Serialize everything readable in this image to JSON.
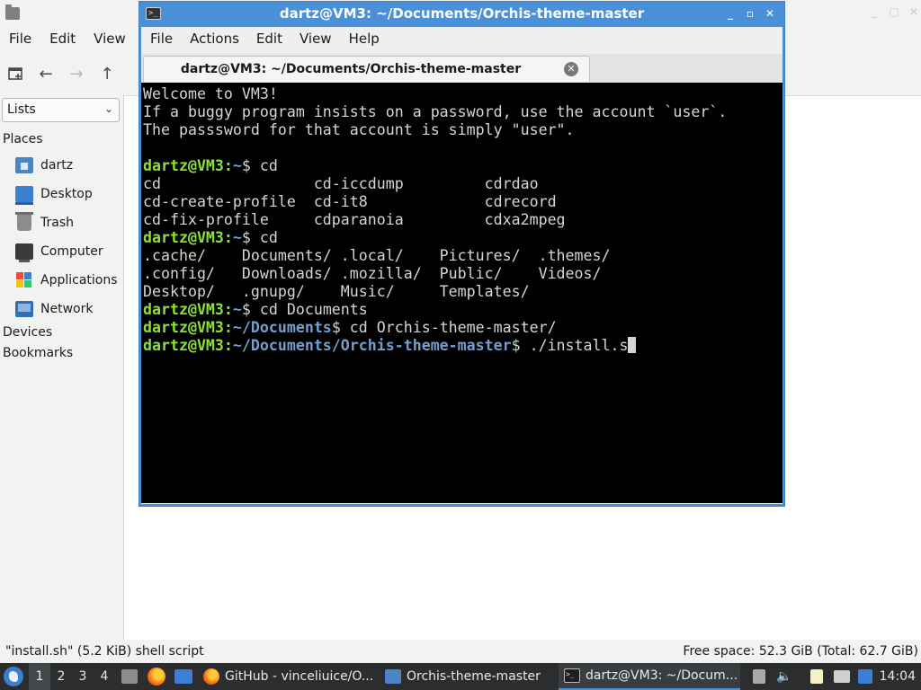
{
  "file_manager": {
    "menu": [
      "File",
      "Edit",
      "View"
    ],
    "sidebar": {
      "select_value": "Lists",
      "places_heading": "Places",
      "places": [
        {
          "label": "dartz",
          "icon": "home-folder-icon"
        },
        {
          "label": "Desktop",
          "icon": "desktop-icon"
        },
        {
          "label": "Trash",
          "icon": "trash-icon"
        },
        {
          "label": "Computer",
          "icon": "computer-icon"
        },
        {
          "label": "Applications",
          "icon": "applications-icon"
        },
        {
          "label": "Network",
          "icon": "network-icon"
        }
      ],
      "devices_heading": "Devices",
      "bookmarks_heading": "Bookmarks"
    },
    "status": {
      "left": "\"install.sh\" (5.2 KiB) shell script",
      "right": "Free space: 52.3 GiB (Total: 62.7 GiB)"
    }
  },
  "terminal": {
    "title": "dartz@VM3: ~/Documents/Orchis-theme-master",
    "menu": [
      "File",
      "Actions",
      "Edit",
      "View",
      "Help"
    ],
    "tab_label": "dartz@VM3: ~/Documents/Orchis-theme-master",
    "lines": {
      "l1": "Welcome to VM3!",
      "l2": "If a buggy program insists on a password, use the account `user`.",
      "l3": "The passsword for that account is simply \"user\".",
      "l4": "",
      "p1_user": "dartz@VM3:",
      "p1_path": "~",
      "p1_cmd": "$ cd",
      "l6": "cd                 cd-iccdump         cdrdao",
      "l7": "cd-create-profile  cd-it8             cdrecord",
      "l8": "cd-fix-profile     cdparanoia         cdxa2mpeg",
      "p2_user": "dartz@VM3:",
      "p2_path": "~",
      "p2_cmd": "$ cd",
      "l10": ".cache/    Documents/ .local/    Pictures/  .themes/",
      "l11": ".config/   Downloads/ .mozilla/  Public/    Videos/",
      "l12": "Desktop/   .gnupg/    Music/     Templates/",
      "p3_user": "dartz@VM3:",
      "p3_path": "~",
      "p3_cmd": "$ cd Documents",
      "p4_user": "dartz@VM3:",
      "p4_path": "~/Documents",
      "p4_cmd": "$ cd Orchis-theme-master/",
      "p5_user": "dartz@VM3:",
      "p5_path": "~/Documents/Orchis-theme-master",
      "p5_cmd": "$ ./install.s"
    }
  },
  "taskbar": {
    "workspaces": [
      "1",
      "2",
      "3",
      "4"
    ],
    "tasks": [
      {
        "label": "GitHub - vinceliuice/O...",
        "icon": "firefox-icon"
      },
      {
        "label": "Orchis-theme-master",
        "icon": "folder-icon"
      },
      {
        "label": "dartz@VM3: ~/Docum...",
        "icon": "terminal-icon"
      }
    ],
    "clock": "14:04"
  },
  "colors": {
    "terminal_accent": "#4a90d9",
    "prompt_user": "#8ae234",
    "prompt_path": "#729fcf",
    "terminal_bg": "#000000"
  }
}
